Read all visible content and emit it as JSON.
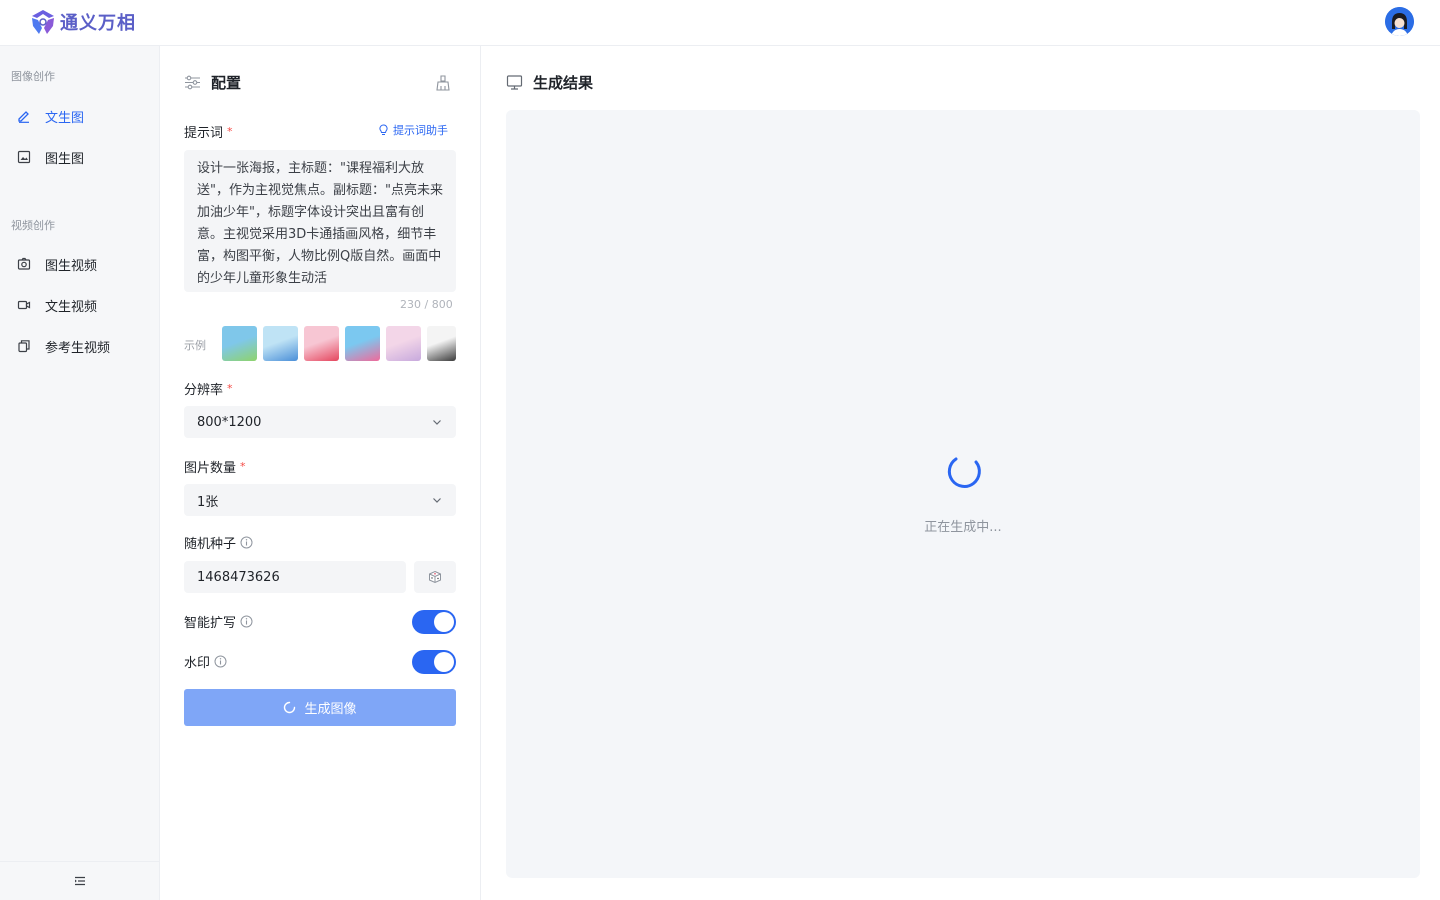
{
  "header": {
    "app_name": "通义万相"
  },
  "sidebar": {
    "groups": [
      {
        "label": "图像创作",
        "items": [
          {
            "label": "文生图",
            "active": true
          },
          {
            "label": "图生图"
          }
        ]
      },
      {
        "label": "视频创作",
        "items": [
          {
            "label": "图生视频"
          },
          {
            "label": "文生视频"
          },
          {
            "label": "参考生视频"
          }
        ]
      }
    ]
  },
  "config": {
    "title": "配置",
    "prompt": {
      "label": "提示词",
      "required_mark": "*",
      "helper_label": "提示词助手",
      "value": "设计一张海报，主标题：\"课程福利大放送\"，作为主视觉焦点。副标题：\"点亮未来 加油少年\"，标题字体设计突出且富有创意。主视觉采用3D卡通插画风格，细节丰富，构图平衡，人物比例Q版自然。画面中的少年儿童形象生动活",
      "counter": "230 / 800"
    },
    "examples": {
      "label": "示例",
      "thumbs": [
        {
          "colors": [
            "#7fc7ea",
            "#8ed36b"
          ]
        },
        {
          "colors": [
            "#bfe3f5",
            "#4a8fd8"
          ]
        },
        {
          "colors": [
            "#f7c6d3",
            "#e5455d"
          ]
        },
        {
          "colors": [
            "#7bc8f0",
            "#f06a9a"
          ]
        },
        {
          "colors": [
            "#f3d6e8",
            "#c7a9dd"
          ]
        },
        {
          "colors": [
            "#f4f4f4",
            "#3a3a3a"
          ]
        }
      ]
    },
    "resolution": {
      "label": "分辨率",
      "required_mark": "*",
      "value": "800*1200"
    },
    "count": {
      "label": "图片数量",
      "required_mark": "*",
      "value": "1张"
    },
    "seed": {
      "label": "随机种子",
      "value": "1468473626"
    },
    "smart_expand": {
      "label": "智能扩写",
      "on": true
    },
    "watermark": {
      "label": "水印",
      "on": true
    },
    "generate_label": "生成图像"
  },
  "result": {
    "title": "生成结果",
    "loading_text": "正在生成中..."
  },
  "colors": {
    "accent": "#2a66f2",
    "button_disabled": "#7fa6f7",
    "brand": "#5b5fc7"
  }
}
